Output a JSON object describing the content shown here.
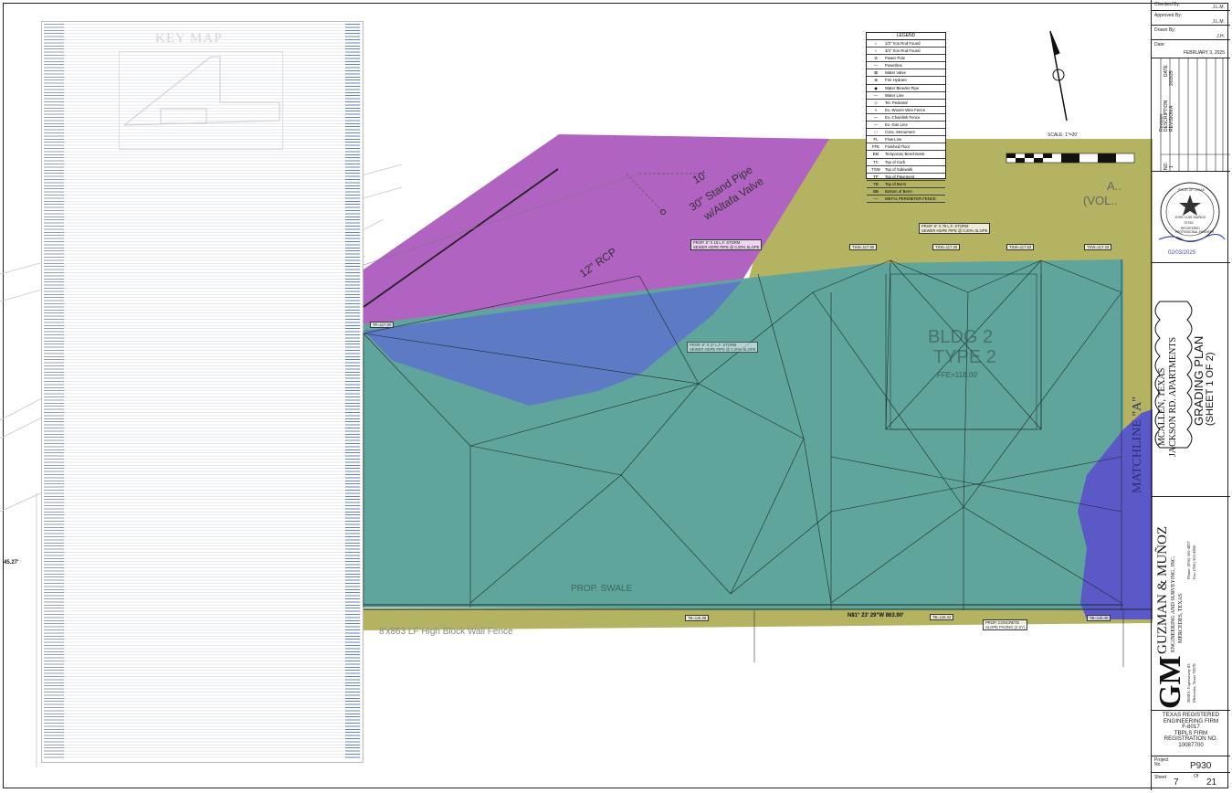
{
  "colors": {
    "magenta": "#b163c1",
    "olive": "#b4b361",
    "teal": "#5fa59c",
    "blue": "#5c7bc4",
    "purple": "#5b59c7"
  },
  "title_block": {
    "checked_label": "Checked By:",
    "checked_value": "J.L.M.",
    "approved_label": "Approved By:",
    "approved_value": "J.L.M.",
    "drawn_label": "Drawn By:",
    "drawn_value": "J.H.",
    "date_label": "Date:",
    "date_value": "FEBRUARY 3, 2025",
    "revision_label": "Revision",
    "revision_desc": "REVISION A",
    "description_label": "DESCRIPTION",
    "date_col": "DATE",
    "rev_date": "2/03/25",
    "no_label": "NO.",
    "rev_no": "1",
    "seal_state": "STATE OF TEXAS",
    "seal_name": "JOSE LUIS MUÑOZ",
    "seal_number": "70782",
    "seal_line1": "REGISTERED",
    "seal_line2": "PROFESSIONAL ENGINEER",
    "seal_date": "02/03/2025",
    "project_city": "MCALLEN, TEXAS",
    "project_name": "JACKSON RD. APARTMENTS",
    "sheet_title": "GRADING PLAN",
    "sheet_subtitle": "(SHEET 1 OF 2)",
    "firm_name": "GUZMAN & MUÑOZ",
    "firm_sub": "ENGINEERING AND SURVEYING, INC.",
    "firm_city": "MERCEDES, TEXAS",
    "firm_addr1": "2020 E. Expressway 83",
    "firm_addr2": "Mercedes, Texas 78570",
    "firm_phone": "Phone: (956) 565-4837",
    "firm_fax": "Fax: (956) 565-4856",
    "logo": "GM",
    "reg1": "TEXAS REGISTERED",
    "reg2": "ENGINEERING FIRM",
    "reg3": "F-8017",
    "reg4": "TBPLS FIRM",
    "reg5": "REGISTRATION NO.",
    "reg6": "10087700",
    "project_label": "Project No.",
    "project_value": "P930",
    "sheet_label": "Sheet",
    "sheet_value": "7",
    "of_label": "Of",
    "of_value": "21"
  },
  "key_map": {
    "title": "KEY MAP"
  },
  "legend": {
    "title": "LEGEND",
    "items": [
      {
        "sym": "○",
        "text": "1/2\" Iron Rod Found"
      },
      {
        "sym": "○",
        "text": "3/4\" Iron Rod Found"
      },
      {
        "sym": "⊘",
        "text": "Power Pole"
      },
      {
        "sym": "—",
        "text": "Powerline"
      },
      {
        "sym": "⊠",
        "text": "Water Valve"
      },
      {
        "sym": "⊕",
        "text": "Fire Hydrant"
      },
      {
        "sym": "◆",
        "text": "Water Bleeder Pipe"
      },
      {
        "sym": "—",
        "text": "Water Line"
      },
      {
        "sym": "◇",
        "text": "Tel. Pedestal"
      },
      {
        "sym": "×",
        "text": "Ex.-Woven Wire Fence"
      },
      {
        "sym": "—",
        "text": "Ex.-Chainlink Fence"
      },
      {
        "sym": "—",
        "text": "Ex.-Gas Line"
      },
      {
        "sym": "□",
        "text": "Conc. Monument"
      },
      {
        "sym": "FL",
        "text": "Flow Line"
      },
      {
        "sym": "FFE",
        "text": "Finished Floor"
      },
      {
        "sym": "BM",
        "text": "Temporary Benchmark"
      },
      {
        "sym": "TC",
        "text": "Top of Curb"
      },
      {
        "sym": "TSW",
        "text": "Top of Sidewalk"
      },
      {
        "sym": "TP",
        "text": "Top of Pavement"
      },
      {
        "sym": "TB",
        "text": "Top of Berm"
      },
      {
        "sym": "BB",
        "text": "Bottom of Berm"
      },
      {
        "sym": "—",
        "text": "METAL PERIMETER FENCE"
      }
    ]
  },
  "scale": {
    "text": "SCALE: 1\"=20'"
  },
  "annotations": {
    "stand_pipe": "30\" Stand Pipe",
    "altafa": "w/Altafa Valve",
    "ten_ft": "10'",
    "rcp": "12\" RCP",
    "storm1a": "PROP. 8\" X 15 L.F. STORM",
    "storm1b": "SEWER HDPE PIPE @ 0.20% SLOPE",
    "storm2a": "PROP. 8\" X 79 L.F. STORM",
    "storm2b": "SEWER HDPE PIPE @ 0.20% SLOPE",
    "storm3a": "PROP. 8\" X 2? L.F. STORM",
    "storm3b": "SEWER HDPE PIPE @ 0.20% SLOPE",
    "bldg": "BLDG 2",
    "type": "TYPE 2",
    "ffe": "FFE=118.00'",
    "matchline": "MATCHLINE \"A\"",
    "vol_a": "A..",
    "vol": "(VOL..",
    "swale": "PROP. SWALE",
    "bearing": "N81° 23' 29\"W 863.90'",
    "conc1": "PROP. CONCRETE",
    "conc2": "SLOPE PAVING (2 SY)",
    "fence": "8'x863 LF High Block Wall Fence",
    "angle": "45.27'",
    "tsw1": "TSW=117.60",
    "tsw2": "TSW=117.26",
    "tsw3": "TSW=117.63",
    "tsw4": "TSW=117.33",
    "tb1": "TB=116.36",
    "tb2": "TB=116.34",
    "tb3": "TB=116.40",
    "tp1": "TP=117.00"
  }
}
